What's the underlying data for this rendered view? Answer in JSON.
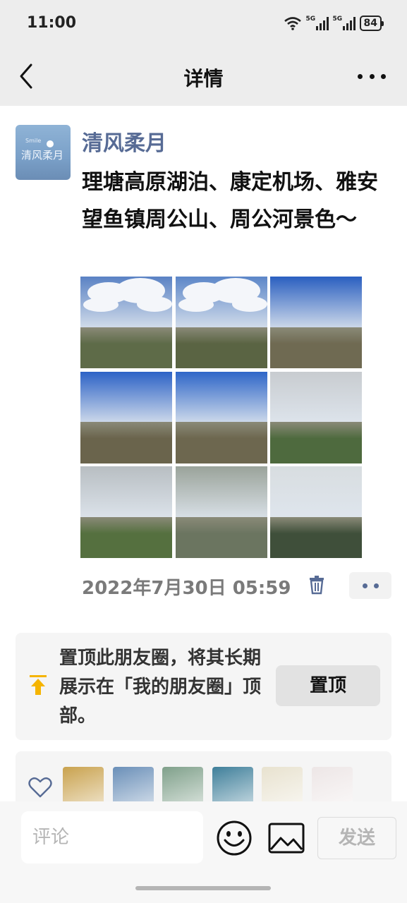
{
  "status_bar": {
    "time": "11:00",
    "signal_1": "5G",
    "signal_2": "5G",
    "battery": "84"
  },
  "nav": {
    "title": "详情"
  },
  "post": {
    "author": "清风柔月",
    "avatar_text": "清风柔月",
    "avatar_small_text": "Smile",
    "text": "理塘高原湖泊、康定机场、雅安望鱼镇周公山、周公河景色～",
    "time": "2022年7月30日 05:59",
    "photos": [
      {
        "name": "photo-plateau-clouds-1",
        "sky": "#5a82c4",
        "ground": "#5e6b48",
        "clouds": true
      },
      {
        "name": "photo-plateau-clouds-2",
        "sky": "#5c86c8",
        "ground": "#5a6443",
        "clouds": true
      },
      {
        "name": "photo-plateau-blue-sky-1",
        "sky": "#2a5fc0",
        "ground": "#6f6a52",
        "clouds": false
      },
      {
        "name": "photo-plateau-blue-sky-2",
        "sky": "#2c62c6",
        "ground": "#6a644c",
        "clouds": false
      },
      {
        "name": "photo-plateau-blue-sky-3",
        "sky": "#2e66c8",
        "ground": "#6d674f",
        "clouds": false
      },
      {
        "name": "photo-misty-forest-1",
        "sky": "#c8ccd0",
        "ground": "#4e6a3e",
        "clouds": false
      },
      {
        "name": "photo-misty-forest-2",
        "sky": "#b8bec2",
        "ground": "#55703f",
        "clouds": false
      },
      {
        "name": "photo-misty-lake",
        "sky": "#9aa39a",
        "ground": "#6b7560",
        "clouds": false
      },
      {
        "name": "photo-mountain-village",
        "sky": "#d8dde0",
        "ground": "#3f4f3a",
        "clouds": false
      }
    ]
  },
  "pin": {
    "text": "置顶此朋友圈，将其长期展示在「我的朋友圈」顶部。",
    "button": "置顶"
  },
  "likes": {
    "avatars": [
      {
        "name": "liker-avatar-1",
        "color": "#c9a24e"
      },
      {
        "name": "liker-avatar-2",
        "color": "#6a8fb8"
      },
      {
        "name": "liker-avatar-3",
        "color": "#7fa08a"
      },
      {
        "name": "liker-avatar-4",
        "color": "#3f7f9a"
      },
      {
        "name": "liker-avatar-5",
        "color": "#e8e2cf"
      },
      {
        "name": "liker-avatar-6",
        "color": "#ede6e6"
      }
    ]
  },
  "composer": {
    "placeholder": "评论",
    "send": "发送"
  },
  "colors": {
    "link_blue": "#576b95",
    "background": "#ededed"
  }
}
